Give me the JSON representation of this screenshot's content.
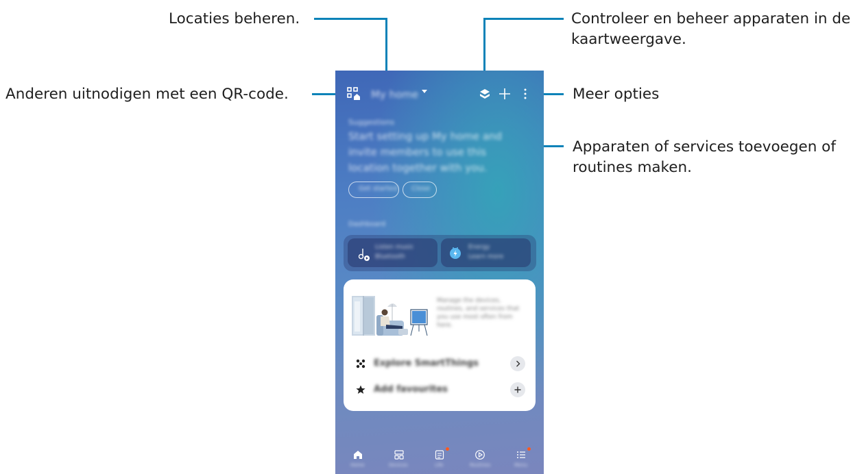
{
  "callouts": {
    "locations": "Locaties beheren.",
    "map_line1": "Controleer en beheer apparaten in de",
    "map_line2": "kaartweergave.",
    "invite": "Anderen uitnodigen met een QR-code.",
    "more": "Meer opties",
    "add_line1": "Apparaten of services toevoegen of",
    "add_line2": "routines maken."
  },
  "app": {
    "location_name": "My home",
    "suggestion_label": "Suggestions",
    "suggestion_lines": [
      "Start setting up My home and",
      "invite members to use this",
      "location together with you."
    ],
    "chip_primary": "Get started",
    "chip_secondary": "Close",
    "dashboard_label": "Dashboard",
    "tile1_line1": "Listen music",
    "tile1_line2": "Bluetooth",
    "tile2_line1": "Energy",
    "tile2_line2": "Learn more",
    "card_text_lines": [
      "Manage the devices,",
      "routines, and services that",
      "you use most often from",
      "here."
    ],
    "card_item1": "Explore SmartThings",
    "card_item2": "Add favourites",
    "nav": [
      "Home",
      "Devices",
      "Life",
      "Routines",
      "Menu"
    ]
  }
}
